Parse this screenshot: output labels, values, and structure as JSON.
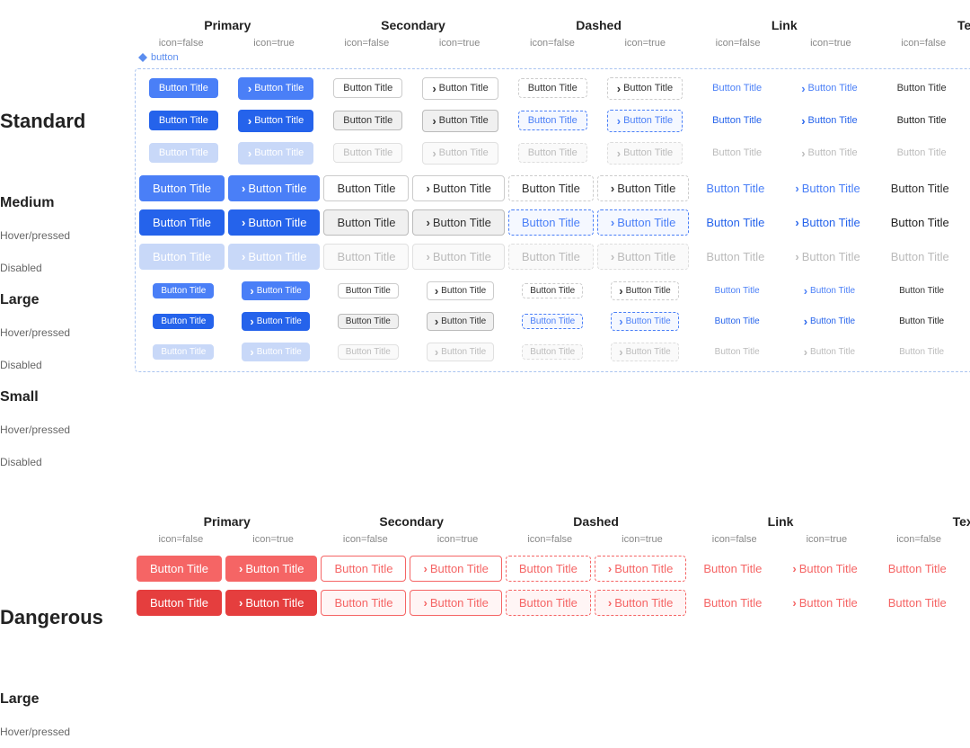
{
  "sections": {
    "standard": {
      "title": "Standard",
      "categories": [
        "Primary",
        "Secondary",
        "Dashed",
        "Link",
        "Text"
      ],
      "sub_labels": [
        "icon=false",
        "icon=true"
      ],
      "marker": "button",
      "rows": [
        {
          "label": "Medium",
          "type": "bold",
          "state": "normal"
        },
        {
          "label": "Hover/pressed",
          "type": "normal",
          "state": "hover"
        },
        {
          "label": "Disabled",
          "type": "normal",
          "state": "disabled"
        },
        {
          "label": "Large",
          "type": "bold",
          "state": "normal"
        },
        {
          "label": "Hover/pressed",
          "type": "normal",
          "state": "hover"
        },
        {
          "label": "Disabled",
          "type": "normal",
          "state": "disabled"
        },
        {
          "label": "Small",
          "type": "bold",
          "state": "normal"
        },
        {
          "label": "Hover/pressed",
          "type": "normal",
          "state": "hover"
        },
        {
          "label": "Disabled",
          "type": "normal",
          "state": "disabled"
        }
      ]
    },
    "dangerous": {
      "title": "Dangerous",
      "categories": [
        "Primary",
        "Secondary",
        "Dashed",
        "Link",
        "Text"
      ],
      "sub_labels": [
        "icon=false",
        "icon=true"
      ],
      "rows": [
        {
          "label": "Large",
          "type": "bold",
          "state": "normal"
        },
        {
          "label": "Hover/pressed",
          "type": "normal",
          "state": "hover"
        }
      ]
    }
  },
  "button_label": "Button Title"
}
